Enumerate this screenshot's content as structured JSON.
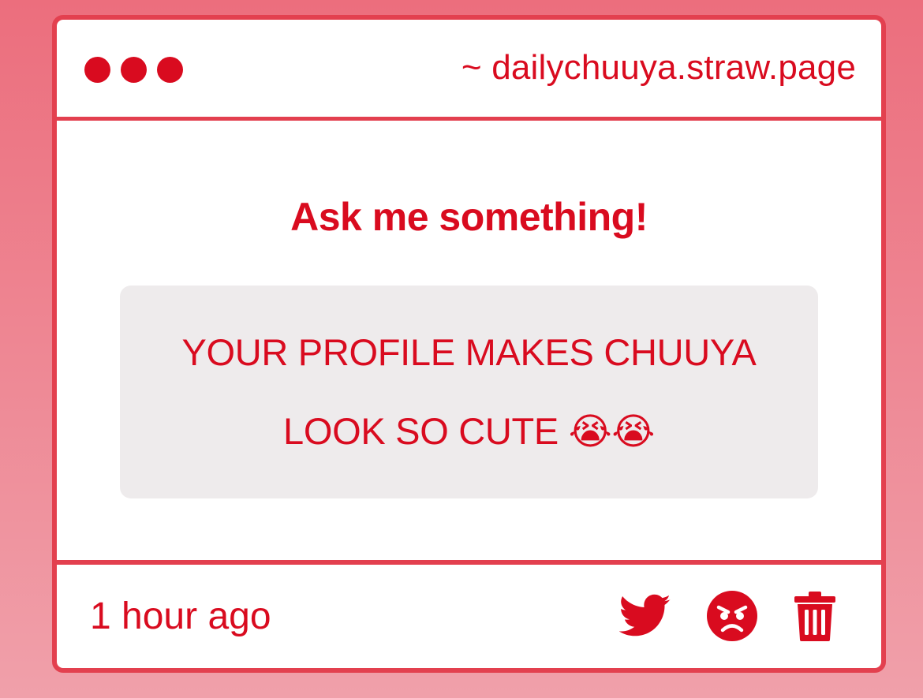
{
  "window": {
    "url": "~ dailychuuya.straw.page"
  },
  "main": {
    "heading": "Ask me something!",
    "question": "YOUR PROFILE MAKES CHUUYA LOOK SO CUTE 😭😭"
  },
  "footer": {
    "timestamp": "1 hour ago",
    "actions": [
      "twitter-icon",
      "angry-face-icon",
      "trash-icon"
    ]
  },
  "colors": {
    "accent": "#d90b1f",
    "border": "#e3404f",
    "card_bg": "#ffffff",
    "question_bg": "#eeebec",
    "page_bg_top": "#ec6e7d",
    "page_bg_bottom": "#f0a0aa"
  }
}
